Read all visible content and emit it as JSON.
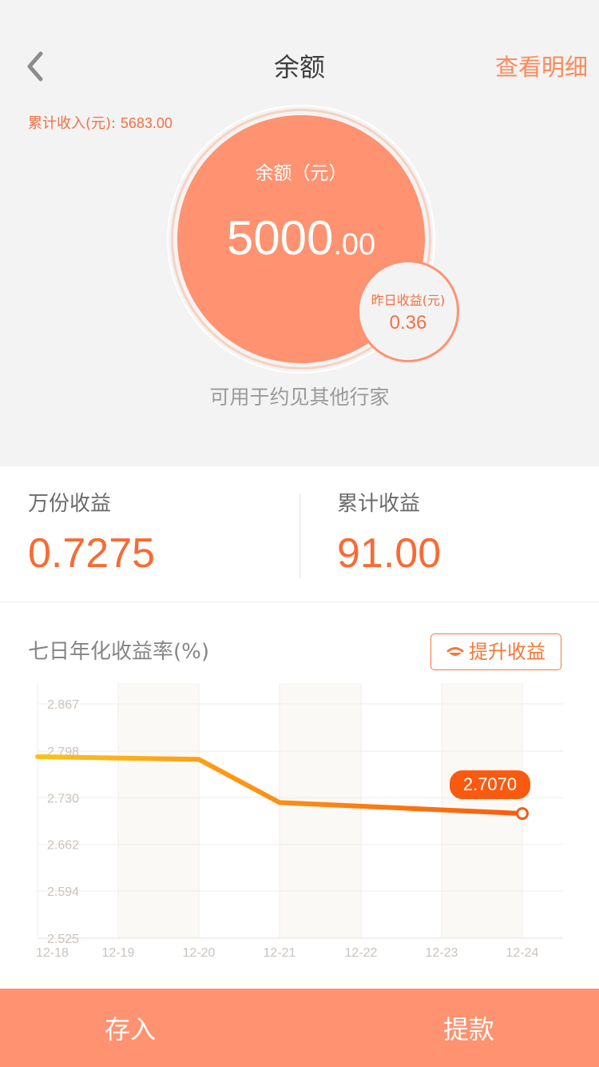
{
  "nav": {
    "title": "余额",
    "detail_link": "查看明细"
  },
  "summary": {
    "cumulative_income_label": "累计收入(元):",
    "cumulative_income_value": "5683.00",
    "balance_label": "余额（元）",
    "balance_int": "5000",
    "balance_dec": ".00",
    "yesterday_label": "昨日收益(元)",
    "yesterday_value": "0.36",
    "usable_note": "可用于约见其他行家"
  },
  "stats": {
    "per_10k_label": "万份收益",
    "per_10k_value": "0.7275",
    "total_label": "累计收益",
    "total_value": "91.00"
  },
  "chart_section": {
    "title": "七日年化收益率(%)",
    "boost_button": "提升收益"
  },
  "chart_data": {
    "type": "line",
    "categories": [
      "12-18",
      "12-19",
      "12-20",
      "12-21",
      "12-22",
      "12-23",
      "12-24"
    ],
    "x": [
      "12-18",
      "12-20",
      "12-21",
      "12-24"
    ],
    "values": [
      2.79,
      2.786,
      2.723,
      2.707
    ],
    "y_ticks": [
      "2.867",
      "2.798",
      "2.730",
      "2.662",
      "2.594",
      "2.525"
    ],
    "ylim": [
      2.525,
      2.867
    ],
    "highlight": {
      "x": "12-24",
      "label": "2.7070"
    },
    "colors": {
      "line_start": "#fcc21b",
      "line_end": "#fb5b0d",
      "callout": "#fa5a10"
    },
    "grid": true
  },
  "actions": {
    "deposit": "存入",
    "withdraw": "提款"
  },
  "icons": {
    "back": "chevron-left-icon",
    "boost": "boost-icon"
  },
  "colors": {
    "accent": "#ff9270",
    "accent_text": "#f47045",
    "value_orange": "#f96a33"
  }
}
